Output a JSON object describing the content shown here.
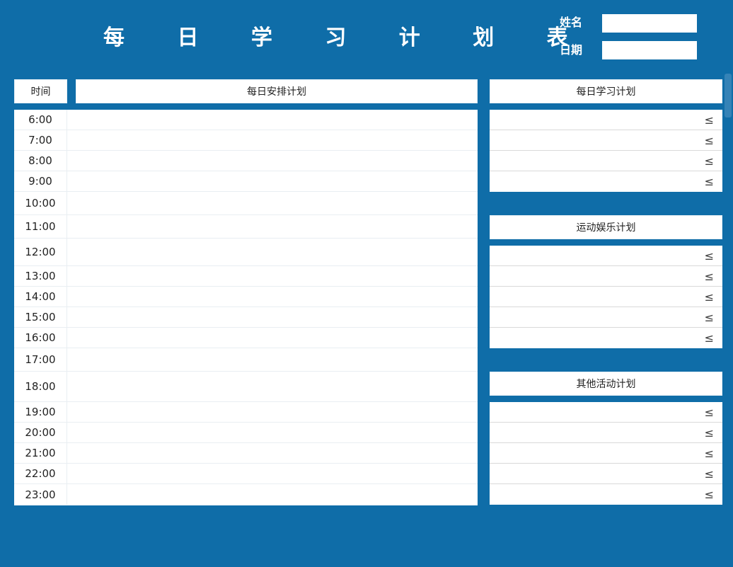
{
  "title": "每 日 学 习 计 划 表",
  "fields": {
    "name_label": "姓名",
    "name_value": "",
    "date_label": "日期",
    "date_value": ""
  },
  "headers": {
    "time": "时间",
    "daily_plan": "每日安排计划",
    "study_plan": "每日学习计划",
    "sports_plan": "运动娱乐计划",
    "other_plan": "其他活动计划"
  },
  "schedule": [
    {
      "time": "6:00",
      "plan": ""
    },
    {
      "time": "7:00",
      "plan": ""
    },
    {
      "time": "8:00",
      "plan": ""
    },
    {
      "time": "9:00",
      "plan": ""
    },
    {
      "time": "10:00",
      "plan": ""
    },
    {
      "time": "11:00",
      "plan": ""
    },
    {
      "time": "12:00",
      "plan": ""
    },
    {
      "time": "13:00",
      "plan": ""
    },
    {
      "time": "14:00",
      "plan": ""
    },
    {
      "time": "15:00",
      "plan": ""
    },
    {
      "time": "16:00",
      "plan": ""
    },
    {
      "time": "17:00",
      "plan": ""
    },
    {
      "time": "18:00",
      "plan": ""
    },
    {
      "time": "19:00",
      "plan": ""
    },
    {
      "time": "20:00",
      "plan": ""
    },
    {
      "time": "21:00",
      "plan": ""
    },
    {
      "time": "22:00",
      "plan": ""
    },
    {
      "time": "23:00",
      "plan": ""
    }
  ],
  "study_items": [
    "≤",
    "≤",
    "≤",
    "≤"
  ],
  "sports_items": [
    "≤",
    "≤",
    "≤",
    "≤",
    "≤"
  ],
  "other_items": [
    "≤",
    "≤",
    "≤",
    "≤",
    "≤"
  ],
  "colors": {
    "background": "#0f6da8",
    "panel": "#ffffff"
  }
}
